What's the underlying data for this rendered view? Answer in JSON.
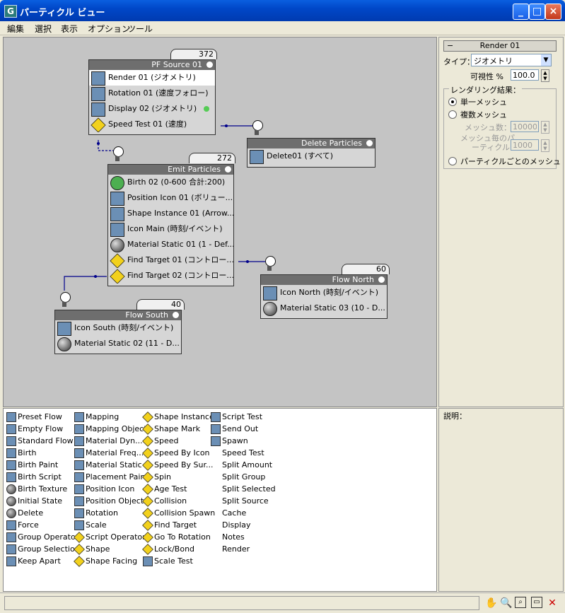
{
  "window": {
    "title": "パーティクル ビュー"
  },
  "menu": [
    "編集",
    "選択",
    "表示",
    "オプション",
    "ツール"
  ],
  "nodes": {
    "pf_source": {
      "title": "PF Source 01",
      "count": "372",
      "rows": [
        "Render 01 (ジオメトリ)",
        "Rotation 01 (速度フォロー)",
        "Display 02 (ジオメトリ)",
        "Speed Test 01 (速度)"
      ]
    },
    "delete_particles": {
      "title": "Delete Particles",
      "rows": [
        "Delete01 (すべて)"
      ]
    },
    "emit_particles": {
      "title": "Emit Particles",
      "count": "272",
      "rows": [
        "Birth 02 (0-600 合計:200)",
        "Position Icon 01 (ボリュー...",
        "Shape Instance 01 (Arrow...",
        "Icon Main (時刻/イベント)",
        "Material Static 01 (1 - Def...",
        "Find Target 01 (コントロー...",
        "Find Target 02 (コントロー..."
      ]
    },
    "flow_north": {
      "title": "Flow North",
      "count": "60",
      "rows": [
        "Icon North (時刻/イベント)",
        "Material Static 03 (10 - D..."
      ]
    },
    "flow_south": {
      "title": "Flow South",
      "count": "40",
      "rows": [
        "Icon South (時刻/イベント)",
        "Material Static 02 (11 - D..."
      ]
    }
  },
  "render_rollout": {
    "title": "Render 01",
    "type_label": "タイプ：",
    "type_value": "ジオメトリ",
    "visibility_label": "可視性 %",
    "visibility_value": "100.0",
    "result_group": "レンダリング結果：",
    "opt_single": "単一メッシュ",
    "opt_multi": "複数メッシュ",
    "mesh_count_label": "メッシュ数：",
    "mesh_count_value": "10000",
    "per_mesh_label_1": "メッシュ毎のパ",
    "per_mesh_label_2": "ーティクル：",
    "per_mesh_value": "1000",
    "opt_per_particle": "パーティクルごとのメッシュ"
  },
  "description": {
    "label": "説明："
  },
  "depot": {
    "col1": [
      "Preset Flow",
      "Empty Flow",
      "Standard Flow",
      "Birth",
      "Birth Paint",
      "Birth Script",
      "Birth Texture",
      "Initial State",
      "Delete",
      "Force",
      "Group Operator",
      "Group Selection",
      "Keep Apart"
    ],
    "col2": [
      "Mapping",
      "Mapping Object",
      "Material Dyn...",
      "Material Freq...",
      "Material Static",
      "Placement Paint",
      "Position Icon",
      "Position Object",
      "Rotation",
      "Scale",
      "Script Operator",
      "Shape",
      "Shape Facing"
    ],
    "col3": [
      "Shape Instance",
      "Shape Mark",
      "Speed",
      "Speed By Icon",
      "Speed By Sur...",
      "Spin",
      "Age Test",
      "Collision",
      "Collision Spawn",
      "Find Target",
      "Go To Rotation",
      "Lock/Bond",
      "Scale Test"
    ],
    "col4": [
      "Script Test",
      "Send Out",
      "Spawn",
      "Speed Test",
      "Split Amount",
      "Split Group",
      "Split Selected",
      "Split Source",
      "Cache",
      "Display",
      "Notes",
      "Render"
    ]
  },
  "status": {
    "tools": [
      "hand-icon",
      "zoom-icon",
      "zoom-region-icon",
      "zoom-extents-icon",
      "no-zoom-icon"
    ]
  }
}
